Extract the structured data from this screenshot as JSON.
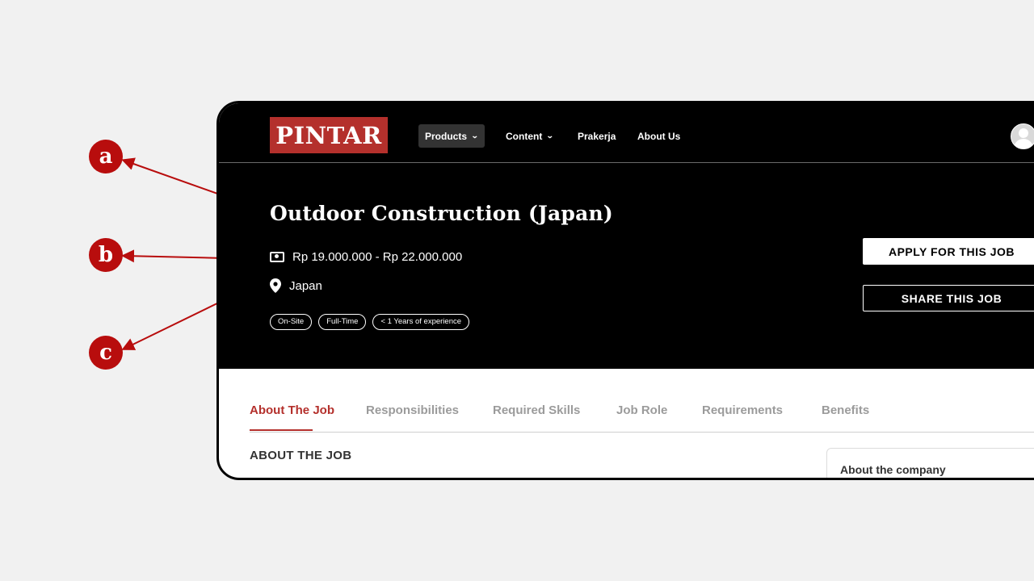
{
  "annotations": {
    "markers": [
      {
        "label": "a"
      },
      {
        "label": "b"
      },
      {
        "label": "c"
      }
    ]
  },
  "header": {
    "logo": "PINTAR",
    "nav": {
      "products": "Products",
      "content": "Content",
      "prakerja": "Prakerja",
      "about_us": "About Us"
    }
  },
  "job": {
    "title": "Outdoor Construction (Japan)",
    "salary": "Rp 19.000.000 - Rp 22.000.000",
    "location": "Japan",
    "tags": [
      "On-Site",
      "Full-Time",
      "< 1 Years of experience"
    ],
    "apply_label": "APPLY FOR THIS JOB",
    "share_label": "SHARE THIS JOB"
  },
  "tabs": [
    {
      "label": "About The Job"
    },
    {
      "label": "Responsibilities"
    },
    {
      "label": "Required Skills"
    },
    {
      "label": "Job Role"
    },
    {
      "label": "Requirements"
    },
    {
      "label": "Benefits"
    }
  ],
  "content": {
    "section_title": "ABOUT THE JOB",
    "company_title": "About the company"
  },
  "colors": {
    "brand": "#b4302c",
    "marker": "#b80d0d",
    "header_bg": "#000000",
    "page_bg": "#f1f1f1"
  }
}
